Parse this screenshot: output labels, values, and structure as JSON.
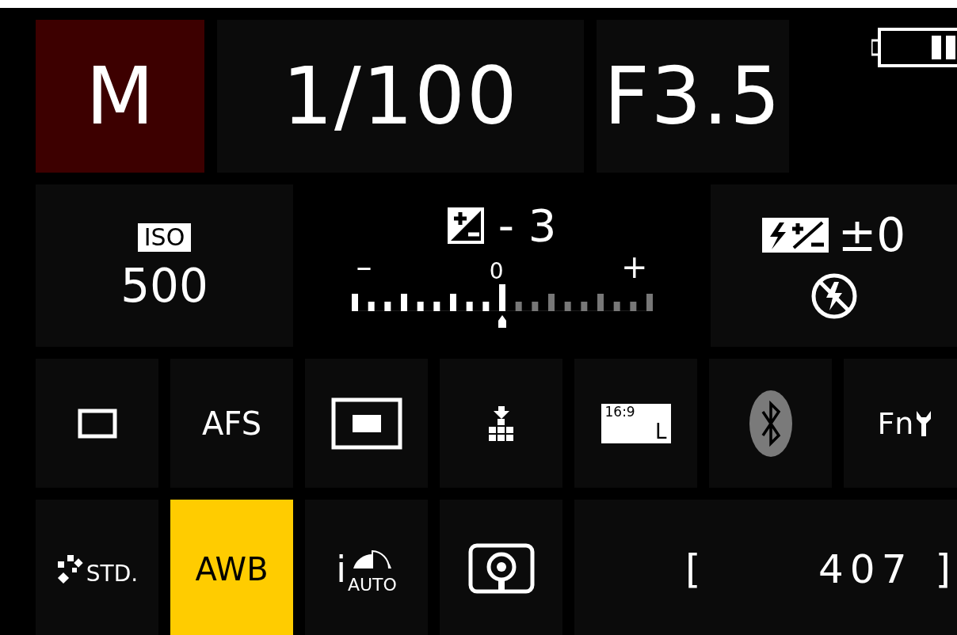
{
  "mode": {
    "label": "M"
  },
  "shutter": "1/100",
  "aperture": "F3.5",
  "iso": {
    "label": "ISO",
    "value": "500"
  },
  "exposure_compensation": {
    "value": "- 3",
    "minus": "–",
    "zero": "0",
    "plus": "+",
    "level": 0.5
  },
  "flash": {
    "compensation": "±0"
  },
  "functions": [
    {
      "kind": "drive",
      "selected": false
    },
    {
      "kind": "text",
      "label": "AFS",
      "selected": false
    },
    {
      "kind": "af_area",
      "selected": false
    },
    {
      "kind": "grid",
      "selected": false
    },
    {
      "kind": "aspect",
      "ratio": "16:9",
      "size": "L",
      "selected": false
    },
    {
      "kind": "bluetooth",
      "connected": false,
      "selected": false
    },
    {
      "kind": "fn",
      "label": "Fn",
      "selected": false
    }
  ],
  "settings": [
    {
      "kind": "photo_style",
      "label": "STD.",
      "selected": false
    },
    {
      "kind": "text",
      "label": "AWB",
      "selected": true
    },
    {
      "kind": "i_dynamic",
      "prefix": "i",
      "label": "AUTO",
      "selected": false
    },
    {
      "kind": "metering",
      "selected": false
    }
  ],
  "shots": {
    "open": "[",
    "count": "407",
    "close": "]"
  }
}
